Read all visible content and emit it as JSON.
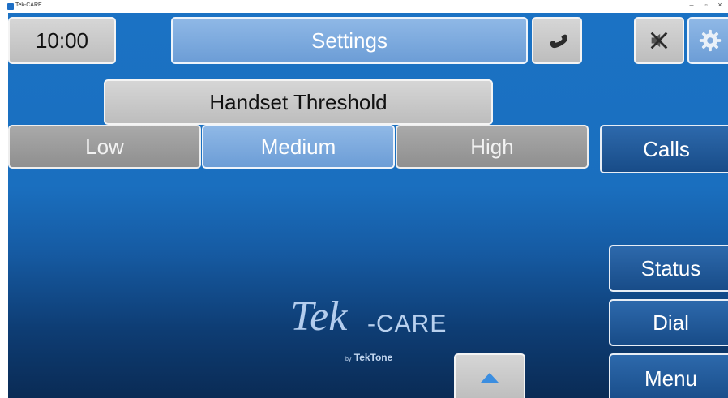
{
  "window": {
    "title": "Tek-CARE",
    "minimize_glyph": "–",
    "restore_glyph": "▫",
    "close_glyph": "×"
  },
  "header": {
    "clock": "10:00",
    "title": "Settings",
    "phone_icon": "phone-icon",
    "mute_icon": "speaker-muted-icon",
    "settings_icon": "gear-icon"
  },
  "threshold": {
    "title": "Handset Threshold",
    "options": [
      "Low",
      "Medium",
      "High"
    ],
    "selected": "Medium"
  },
  "nav": {
    "calls": "Calls",
    "status": "Status",
    "dial": "Dial",
    "menu": "Menu"
  },
  "logo": {
    "tek": "Tek",
    "care": "-CARE",
    "by_prefix": "by",
    "by_brand": "TekTone"
  },
  "colors": {
    "background": "#1b72c4",
    "selected_option": "#7eaae0",
    "unselected_option": "#9d9d9d",
    "nav_button": "#1f5695"
  }
}
